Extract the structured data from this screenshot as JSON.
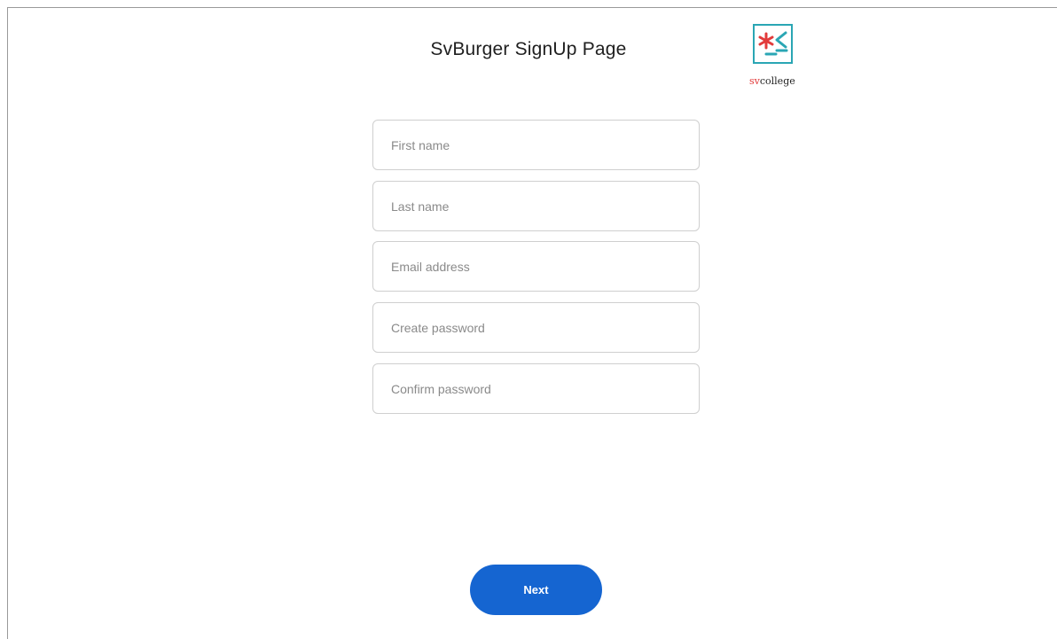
{
  "page": {
    "title": "SvBurger SignUp Page"
  },
  "logo": {
    "text_sv": "sv",
    "text_rest": "college",
    "colors": {
      "border": "#2aa6b4",
      "star": "#e23b3b",
      "chevron": "#2aa6b4"
    }
  },
  "form": {
    "fields": [
      {
        "name": "first-name-field",
        "placeholder": "First name",
        "value": ""
      },
      {
        "name": "last-name-field",
        "placeholder": "Last name",
        "value": ""
      },
      {
        "name": "email-field",
        "placeholder": "Email address",
        "value": ""
      },
      {
        "name": "create-password-field",
        "placeholder": "Create password",
        "value": ""
      },
      {
        "name": "confirm-password-field",
        "placeholder": "Confirm password",
        "value": ""
      }
    ],
    "next_label": "Next"
  },
  "colors": {
    "accent": "#1565d1",
    "field_border": "#cfcfcf"
  }
}
